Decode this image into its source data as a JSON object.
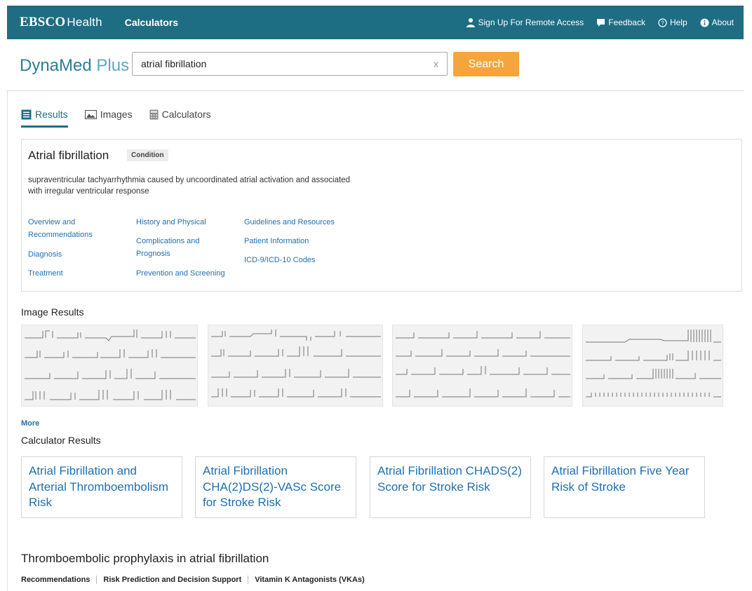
{
  "topbar": {
    "brand_main": "EBSCO",
    "brand_sub": "Health",
    "calculators_label": "Calculators",
    "links": [
      {
        "label": "Sign Up For Remote Access",
        "icon": "user-icon"
      },
      {
        "label": "Feedback",
        "icon": "comment-icon"
      },
      {
        "label": "Help",
        "icon": "help-icon"
      },
      {
        "label": "About",
        "icon": "info-icon"
      }
    ],
    "background_color": "#1e6d83"
  },
  "header": {
    "logo_main": "DynaMed",
    "logo_plus": "Plus",
    "search_value": "atrial fibrillation",
    "clear_label": "x",
    "search_button": "Search",
    "search_button_color": "#f5a53b"
  },
  "tabs": [
    {
      "label": "Results",
      "icon": "results-icon",
      "active": true
    },
    {
      "label": "Images",
      "icon": "image-icon",
      "active": false
    },
    {
      "label": "Calculators",
      "icon": "calculator-icon",
      "active": false
    }
  ],
  "condition": {
    "title": "Atrial fibrillation",
    "badge": "Condition",
    "description": "supraventricular tachyarrhythmia caused by uncoordinated atrial activation and associated with irregular ventricular response",
    "links": [
      "Overview and Recommendations",
      "Diagnosis",
      "Treatment",
      "History and Physical",
      "Complications and Prognosis",
      "Prevention and Screening",
      "Guidelines and Resources",
      "Patient Information",
      "ICD-9/ICD-10 Codes"
    ]
  },
  "image_results": {
    "title": "Image Results",
    "images": [
      "ecg-thumbnail-1",
      "ecg-thumbnail-2",
      "ecg-thumbnail-3",
      "ecg-thumbnail-4"
    ],
    "more_label": "More"
  },
  "calculator_results": {
    "title": "Calculator Results",
    "cards": [
      "Atrial Fibrillation and Arterial Thromboembolism Risk",
      "Atrial Fibrillation CHA(2)DS(2)-VASc Score for Stroke Risk",
      "Atrial Fibrillation CHADS(2) Score for Stroke Risk",
      "Atrial Fibrillation Five Year Risk of Stroke"
    ]
  },
  "thromboembolic": {
    "title": "Thromboembolic prophylaxis in atrial fibrillation",
    "subtabs": [
      "Recommendations",
      "Risk Prediction and Decision Support",
      "Vitamin K Antagonists (VKAs)"
    ]
  }
}
